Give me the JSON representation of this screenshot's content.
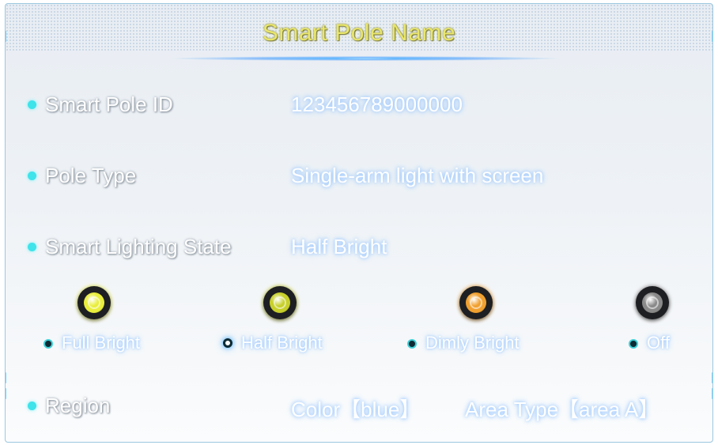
{
  "title": "Smart Pole Name",
  "rows": {
    "pole_id": {
      "label": "Smart Pole ID",
      "value": "123456789000000"
    },
    "pole_type": {
      "label": "Pole Type",
      "value": "Single-arm light with screen"
    },
    "lighting_state": {
      "label": "Smart Lighting State",
      "value": "Half Bright"
    },
    "region": {
      "label": "Region",
      "color": "Color【blue】",
      "area_type": "Area Type【area A】"
    }
  },
  "lighting_options": [
    {
      "label": "Full Bright",
      "lamp_color": "#e9ee3c",
      "selected": false
    },
    {
      "label": "Half Bright",
      "lamp_color": "#c7cf2a",
      "selected": true
    },
    {
      "label": "Dimly Bright",
      "lamp_color": "#f0a030",
      "selected": false
    },
    {
      "label": "Off",
      "lamp_color": "#8a8a8a",
      "selected": false
    }
  ],
  "colors": {
    "accent_dot": "#3fe3ea",
    "title": "#e9e66a"
  }
}
